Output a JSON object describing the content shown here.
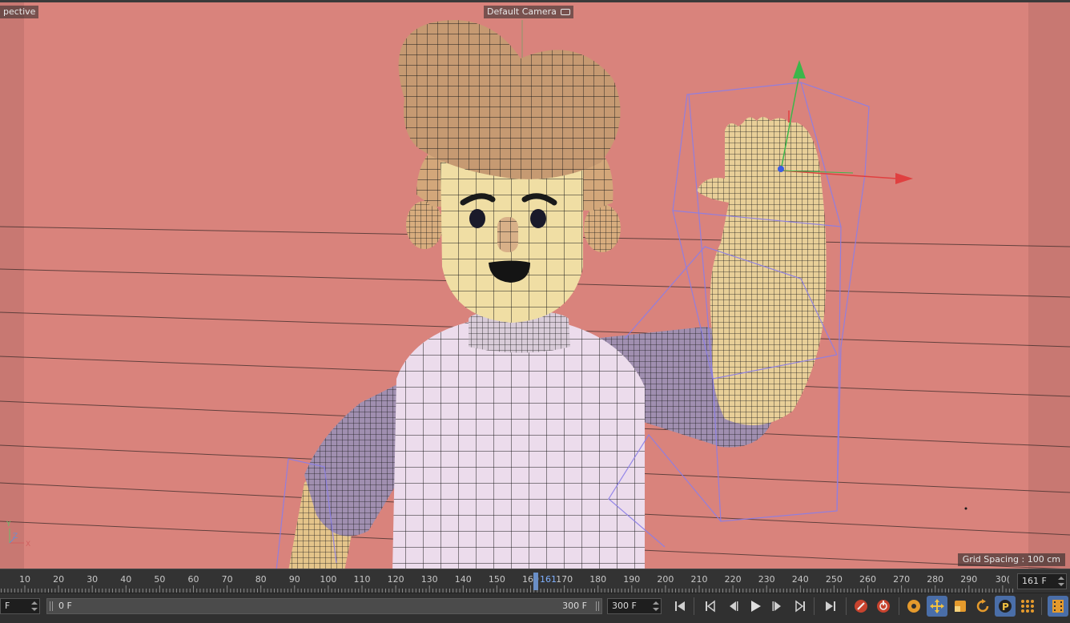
{
  "viewport": {
    "name": "pective",
    "camera": "Default Camera",
    "grid_spacing": "Grid Spacing : 100 cm",
    "axis_y": "Y",
    "axis_z": "Z",
    "axis_x": "X"
  },
  "timeline": {
    "tick_labels": [
      "10",
      "20",
      "30",
      "40",
      "50",
      "60",
      "70",
      "80",
      "90",
      "100",
      "110",
      "120",
      "130",
      "140",
      "150",
      "160",
      "170",
      "180",
      "190",
      "200",
      "210",
      "220",
      "230",
      "240",
      "250",
      "260",
      "270",
      "280",
      "290",
      "30("
    ],
    "playhead_label": "161",
    "current_frame": "161 F"
  },
  "controls": {
    "left_field": "F",
    "range_start": "0 F",
    "range_end": "300 F",
    "max_field": "300 F"
  },
  "icons": {
    "go_start": "go-to-start-icon",
    "prev_key": "previous-keyframe-icon",
    "prev_frame": "previous-frame-icon",
    "play": "play-icon",
    "next_frame": "next-frame-icon",
    "next_key": "next-keyframe-icon",
    "go_end": "go-to-end-icon",
    "record": "record-keys-icon",
    "autokey": "autokey-icon",
    "key_props": "keyframe-settings-icon",
    "move": "move-keys-icon",
    "scale": "scale-keys-icon",
    "rotate": "rotate-keys-icon",
    "param": "parameter-keys-icon",
    "pla": "pla-keys-icon",
    "timeline": "timeline-window-icon"
  },
  "colors": {
    "viewport_bg": "#d9837c",
    "accent": "#4a6ea8",
    "record": "#c8432e"
  }
}
